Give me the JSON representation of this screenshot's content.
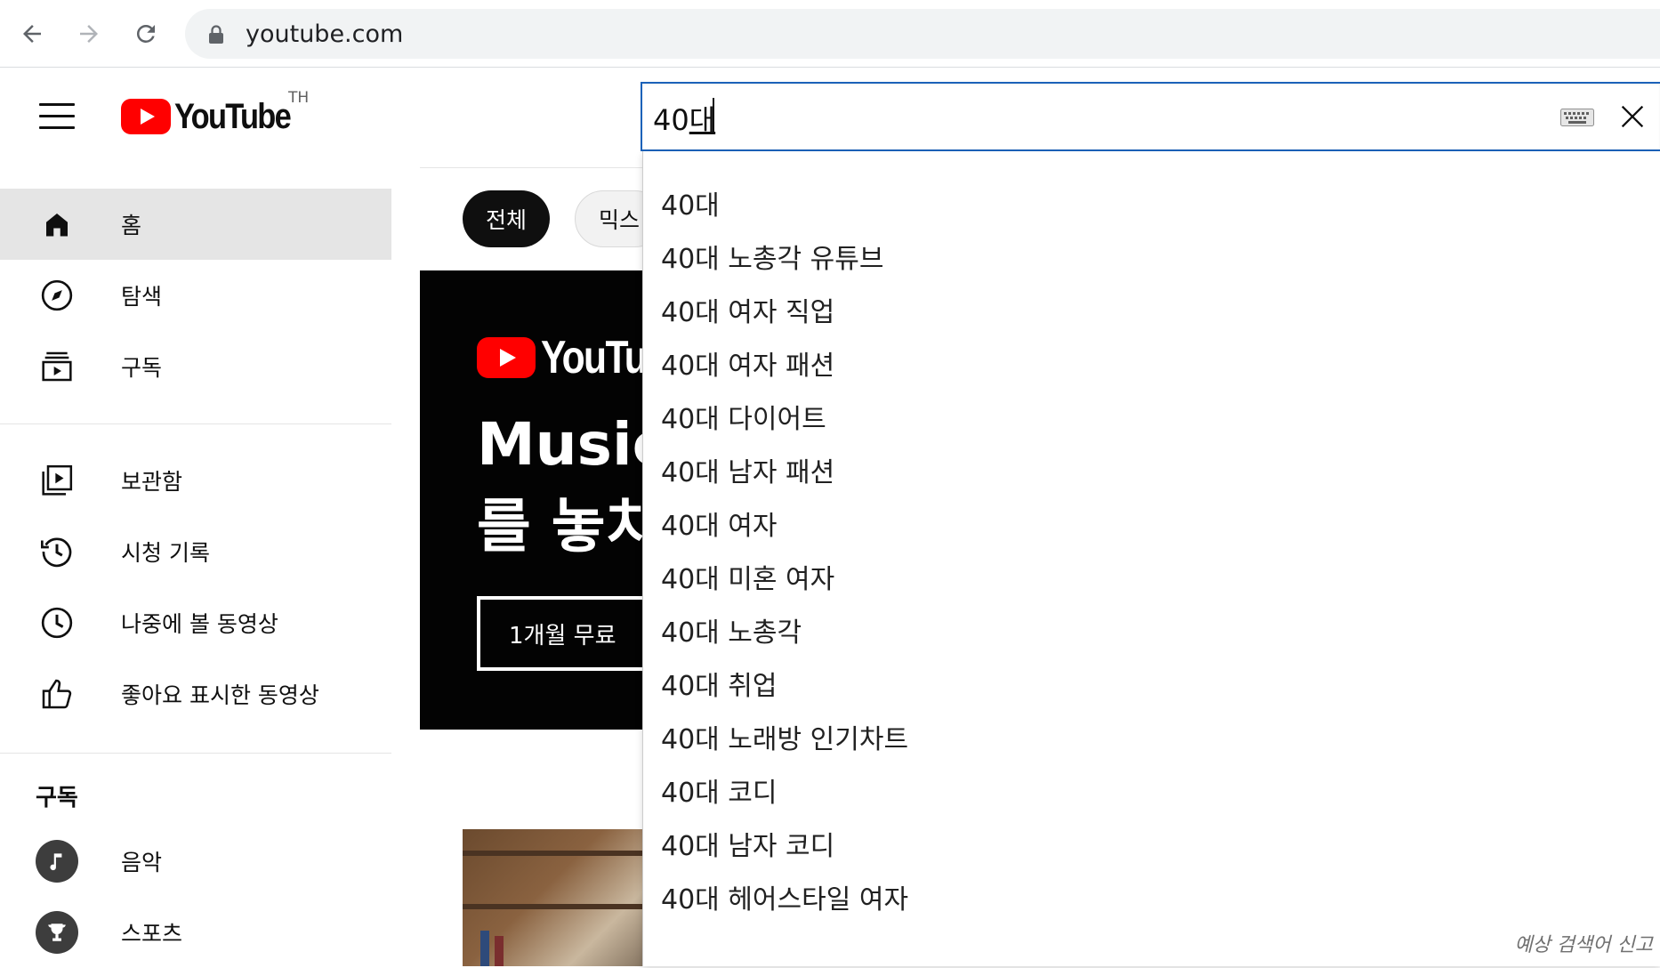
{
  "browser": {
    "back_icon": "arrow-left-icon",
    "forward_icon": "arrow-right-icon",
    "reload_icon": "reload-icon",
    "url": "youtube.com"
  },
  "masthead": {
    "logo_text": "YouTube",
    "region": "TH"
  },
  "sidebar": {
    "primary": [
      {
        "label": "홈",
        "icon": "home-icon",
        "active": true
      },
      {
        "label": "탐색",
        "icon": "compass-icon"
      },
      {
        "label": "구독",
        "icon": "subscriptions-icon"
      }
    ],
    "library": [
      {
        "label": "보관함",
        "icon": "library-icon"
      },
      {
        "label": "시청 기록",
        "icon": "history-icon"
      },
      {
        "label": "나중에 볼 동영상",
        "icon": "watch-later-icon"
      },
      {
        "label": "좋아요 표시한 동영상",
        "icon": "thumbs-up-icon"
      }
    ],
    "subscriptions_title": "구독",
    "subscriptions": [
      {
        "label": "음악",
        "icon": "music-note-icon"
      },
      {
        "label": "스포츠",
        "icon": "trophy-icon"
      }
    ]
  },
  "chips": {
    "all": "전체",
    "mix": "믹스"
  },
  "banner": {
    "logo_text": "YouTube",
    "title_line1": "Music",
    "title_line2": "를 놓치",
    "cta": "1개월 무료"
  },
  "search": {
    "query_prefix": "40",
    "query_composing": "대",
    "keyboard_icon": "keyboard-icon",
    "clear_icon": "close-icon",
    "suggestions": [
      "40대",
      "40대 노총각 유튜브",
      "40대 여자 직업",
      "40대 여자 패션",
      "40대 다이어트",
      "40대 남자 패션",
      "40대 여자",
      "40대 미혼 여자",
      "40대 노총각",
      "40대 취업",
      "40대 노래방 인기차트",
      "40대 코디",
      "40대 남자 코디",
      "40대 헤어스타일 여자"
    ],
    "report_label": "예상 검색어 신고"
  },
  "colors": {
    "brand_red": "#ff0000",
    "focus_blue": "#1c62b9",
    "active_bg": "#e5e5e5"
  }
}
